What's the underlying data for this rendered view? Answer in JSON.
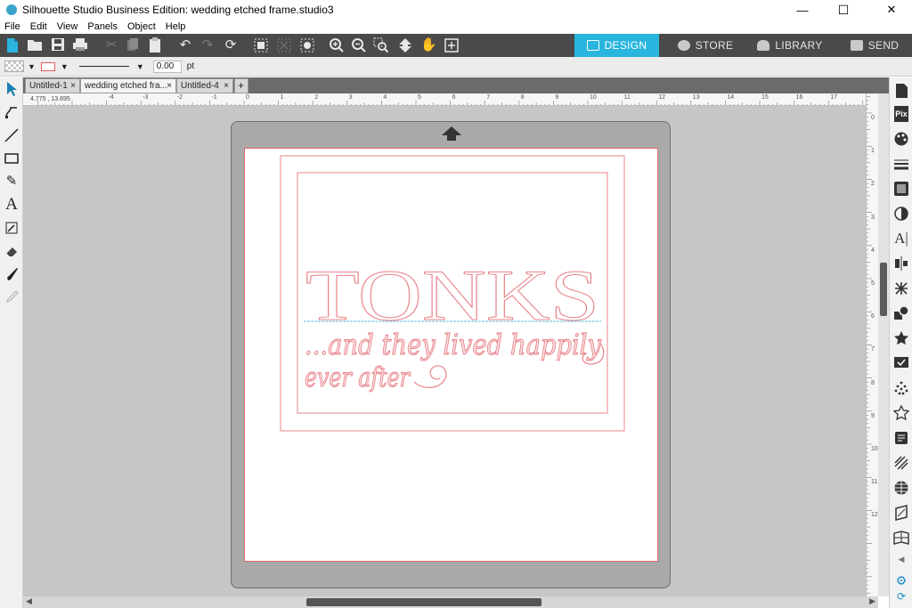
{
  "window": {
    "title": "Silhouette Studio Business Edition: wedding etched frame.studio3",
    "minimize_glyph": "—",
    "maximize_glyph": "☐",
    "close_glyph": "✕"
  },
  "menu": [
    "File",
    "Edit",
    "View",
    "Panels",
    "Object",
    "Help"
  ],
  "nav_tabs": [
    {
      "label": "DESIGN",
      "active": true
    },
    {
      "label": "STORE",
      "active": false
    },
    {
      "label": "LIBRARY",
      "active": false
    },
    {
      "label": "SEND",
      "active": false
    }
  ],
  "properties": {
    "line_width_value": "0.00",
    "line_width_unit": "pt",
    "line_color": "#e05a5a"
  },
  "doc_tabs": [
    {
      "label": "Untitled-1",
      "active": false
    },
    {
      "label": "wedding etched fra...",
      "active": true
    },
    {
      "label": "Untitled-4",
      "active": false
    }
  ],
  "new_tab_glyph": "+",
  "tab_close_glyph": "×",
  "ruler_top": {
    "left_readout": "4.775 , 13.695",
    "labels": [
      "-4",
      "-3",
      "-2",
      "-1",
      "0",
      "1",
      "2",
      "3",
      "4",
      "5",
      "6",
      "7",
      "8",
      "9",
      "10",
      "11",
      "12",
      "13",
      "14",
      "15",
      "16",
      "17"
    ]
  },
  "ruler_right": {
    "labels": [
      "-1",
      "0",
      "1",
      "2",
      "3",
      "4",
      "5",
      "6",
      "7",
      "8",
      "9",
      "10",
      "11",
      "12"
    ]
  },
  "design": {
    "headline": "TONKS",
    "script_line_1": "...and they lived happily",
    "script_line_2": "ever after",
    "cut_line_color": "#e8848a",
    "baseline_color": "#5bb8e0"
  },
  "icons": {
    "toolbar": [
      "new-document-icon",
      "open-icon",
      "save-icon",
      "print-icon",
      "cut-icon",
      "copy-icon",
      "paste-icon",
      "undo-icon",
      "redo-icon",
      "redraw-icon",
      "group-icon",
      "ungroup-icon",
      "trace-icon",
      "zoom-in-icon",
      "zoom-out-icon",
      "zoom-select-icon",
      "pan-down-icon",
      "hand-icon",
      "fit-page-icon"
    ],
    "left_tools": [
      "select-arrow-icon",
      "point-edit-icon",
      "line-icon",
      "rectangle-icon",
      "pencil-icon",
      "text-icon",
      "trace-tool-icon",
      "eraser-icon",
      "knife-icon",
      "eyedropper-icon"
    ],
    "right_panels": [
      "page-setup-icon",
      "pixscan-icon",
      "palette-icon",
      "line-style-icon",
      "fill-pattern-icon",
      "gradient-icon",
      "text-style-icon",
      "align-icon",
      "replicate-icon",
      "modify-icon",
      "offset-icon",
      "trace-panel-icon",
      "sketch-icon",
      "rhinestone-icon",
      "favorites-icon",
      "layers-icon",
      "hatch-icon",
      "nesting-icon",
      "emboss-icon",
      "flexi-icon",
      "settings-icon"
    ]
  }
}
